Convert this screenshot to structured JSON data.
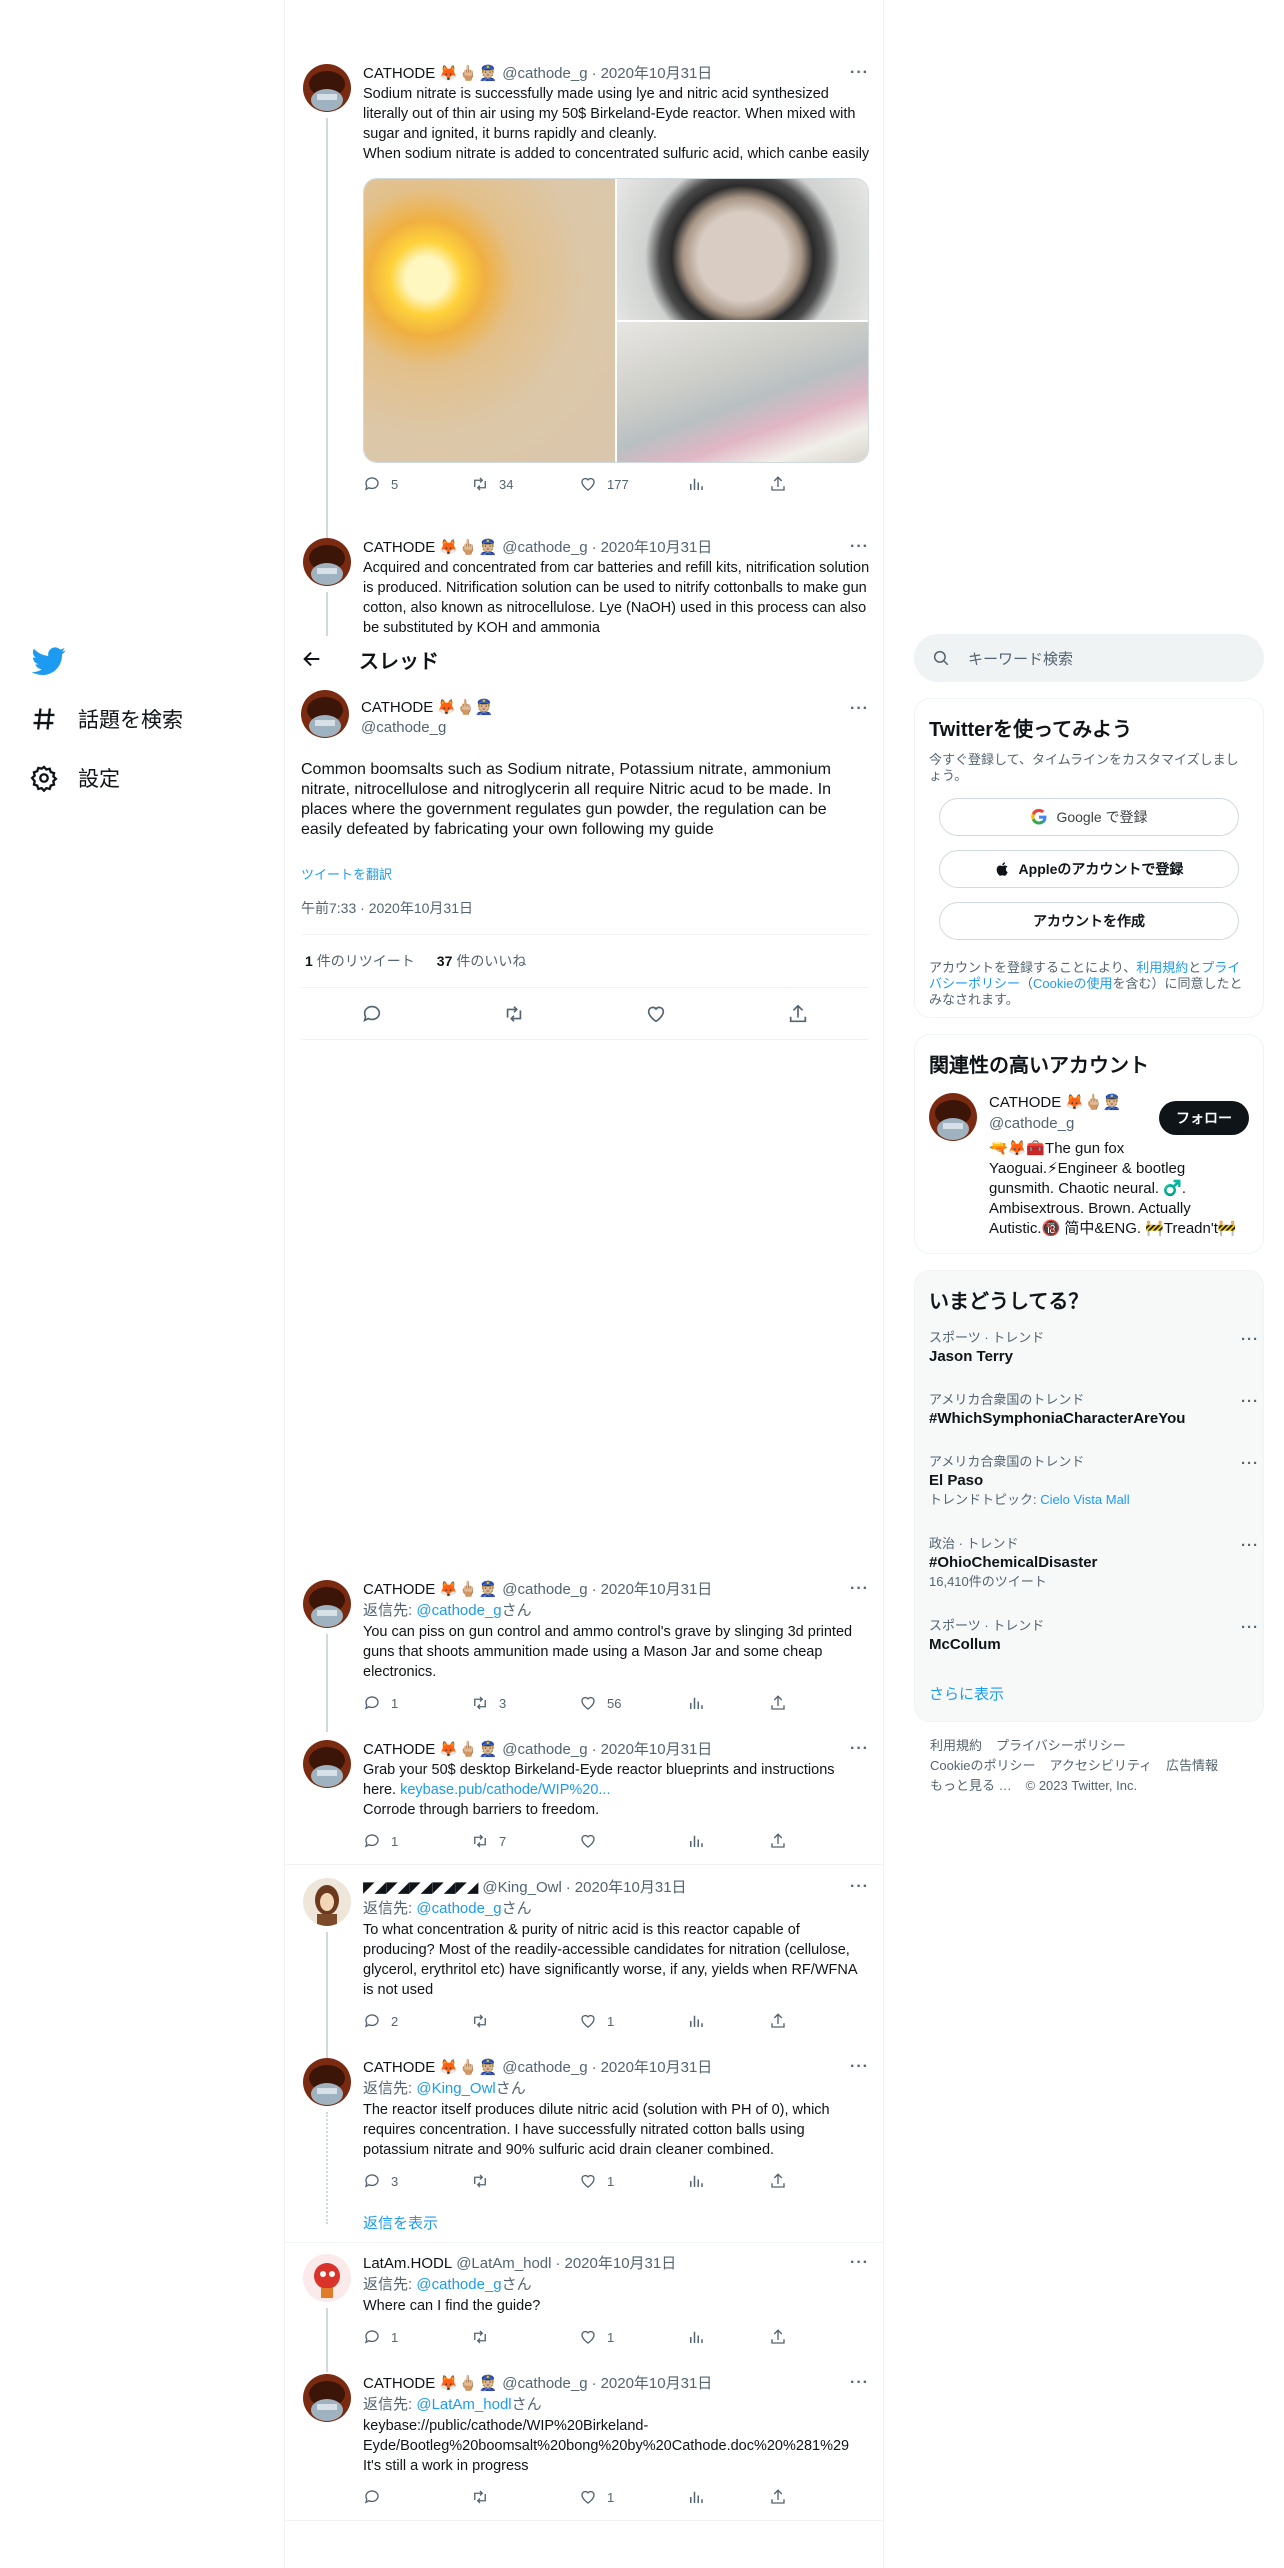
{
  "nav": {
    "explore_label": "話題を検索",
    "settings_label": "設定"
  },
  "thread": {
    "header_title": "スレッド",
    "translate_label": "ツイートを翻訳",
    "show_replies_label": "返信を表示",
    "reply_prefix": "返信先: ",
    "reply_suffix": "さん"
  },
  "author": {
    "name": "CATHODE",
    "emoji": "🦊🖕🏼👮🏼",
    "handle": "@cathode_g",
    "date": "2020年10月31日"
  },
  "tweets_above": [
    {
      "text": "Sodium nitrate is successfully made using lye and nitric acid synthesized literally out of thin air using my 50$ Birkeland-Eyde reactor. When mixed with sugar and ignited, it burns rapidly and cleanly.\nWhen sodium nitrate is added to concentrated sulfuric acid, which canbe easily",
      "replies": "5",
      "retweets": "34",
      "likes": "177"
    },
    {
      "text": "Acquired and concentrated from car batteries and refill kits, nitrification solution is produced. Nitrification solution can be used to nitrify cottonballs to make gun cotton, also known as nitrocellulose. Lye (NaOH) used in this process can also be substituted by KOH and ammonia"
    }
  ],
  "focal": {
    "text": "Common boomsalts such as Sodium nitrate, Potassium nitrate, ammonium nitrate, nitrocellulose and nitroglycerin all require Nitric acud to be made. In places where the government regulates gun powder, the regulation can be easily defeated by fabricating your own following my guide",
    "time": "午前7:33 · 2020年10月31日",
    "retweets": "1",
    "retweets_label": "件のリツイート",
    "likes": "37",
    "likes_label": "件のいいね"
  },
  "replies": [
    {
      "name": "CATHODE",
      "emoji": "🦊🖕🏼👮🏼",
      "handle": "@cathode_g",
      "date": "2020年10月31日",
      "reply_to": "@cathode_g",
      "text": "You can piss on gun control and ammo control's grave by slinging 3d printed guns that shoots ammunition made using a Mason Jar and some cheap electronics.",
      "replies": "1",
      "retweets": "3",
      "likes": "56"
    },
    {
      "name": "CATHODE",
      "emoji": "🦊🖕🏼👮🏼",
      "handle": "@cathode_g",
      "date": "2020年10月31日",
      "text_before_link": "Grab your 50$ desktop Birkeland-Eyde reactor blueprints and instructions here. ",
      "link": "keybase.pub/cathode/WIP%20...",
      "text_after_link": "Corrode through barriers to freedom.",
      "replies": "1",
      "retweets": "7",
      "likes": ""
    },
    {
      "name": "◤◢◤◢◤◢◤◢◤◢",
      "emoji": "",
      "handle": "@King_Owl",
      "date": "2020年10月31日",
      "reply_to": "@cathode_g",
      "text": "To what concentration & purity of nitric acid is this reactor capable of producing? Most of the readily-accessible candidates for nitration (cellulose, glycerol, erythritol etc) have significantly worse, if any, yields when RF/WFNA is not used",
      "replies": "2",
      "retweets": "",
      "likes": "1"
    },
    {
      "name": "CATHODE",
      "emoji": "🦊🖕🏼👮🏼",
      "handle": "@cathode_g",
      "date": "2020年10月31日",
      "reply_to": "@King_Owl",
      "text": "The reactor itself produces dilute nitric acid (solution with PH of 0), which requires concentration. I have successfully nitrated cotton balls using potassium nitrate and 90% sulfuric acid drain cleaner combined.",
      "replies": "3",
      "retweets": "",
      "likes": "1"
    },
    {
      "name": "LatAm.HODL",
      "emoji": "",
      "handle": "@LatAm_hodl",
      "date": "2020年10月31日",
      "reply_to": "@cathode_g",
      "text": "Where can I find the guide?",
      "replies": "1",
      "retweets": "",
      "likes": "1"
    },
    {
      "name": "CATHODE",
      "emoji": "🦊🖕🏼👮🏼",
      "handle": "@cathode_g",
      "date": "2020年10月31日",
      "reply_to": "@LatAm_hodl",
      "text": "keybase://public/cathode/WIP%20Birkeland-Eyde/Bootleg%20boomsalt%20bong%20by%20Cathode.doc%20%281%29\nIt's still a work in progress",
      "replies": "",
      "retweets": "",
      "likes": "1"
    }
  ],
  "sidebar": {
    "search_placeholder": "キーワード検索",
    "signup": {
      "title": "Twitterを使ってみよう",
      "subtitle": "今すぐ登録して、タイムラインをカスタマイズしましょう。",
      "google_label": "Google で登録",
      "apple_label": "Appleのアカウントで登録",
      "create_label": "アカウントを作成",
      "legal_before": "アカウントを登録することにより、",
      "legal_link1": "利用規約",
      "legal_mid1": "と",
      "legal_link2": "プライバシーポリシー",
      "legal_mid2": "（",
      "legal_link3": "Cookieの使用",
      "legal_after": "を含む）に同意したとみなされます。"
    },
    "related": {
      "title": "関連性の高いアカウント",
      "name": "CATHODE 🦊🖕🏼👮🏼",
      "handle": "@cathode_g",
      "follow_label": "フォロー",
      "bio": "🔫🦊🧰The gun fox Yaoguai.⚡Engineer & bootleg gunsmith. Chaotic neural. ♂️. Ambisextrous. Brown. Actually Autistic.🔞 简中&ENG. 🚧Treadn't🚧"
    },
    "trends": {
      "title": "いまどうしてる？",
      "items": [
        {
          "category": "スポーツ · トレンド",
          "title": "Jason Terry",
          "meta": ""
        },
        {
          "category": "アメリカ合衆国のトレンド",
          "title": "#WhichSymphoniaCharacterAreYou",
          "meta": ""
        },
        {
          "category": "アメリカ合衆国のトレンド",
          "title": "El Paso",
          "meta_prefix": "トレンドトピック: ",
          "meta_link": "Cielo Vista Mall"
        },
        {
          "category": "政治 · トレンド",
          "title": "#OhioChemicalDisaster",
          "meta": "16,410件のツイート"
        },
        {
          "category": "スポーツ · トレンド",
          "title": "McCollum",
          "meta": ""
        }
      ],
      "show_more": "さらに表示"
    },
    "footer": {
      "links": [
        "利用規約",
        "プライバシーポリシー",
        "Cookieのポリシー",
        "アクセシビリティ",
        "広告情報",
        "もっと見る …"
      ],
      "copyright": "© 2023 Twitter, Inc."
    }
  },
  "colors": {
    "accent": "#1d9bf0",
    "text": "#0f1419",
    "secondary": "#536471",
    "border": "#eff3f4"
  }
}
